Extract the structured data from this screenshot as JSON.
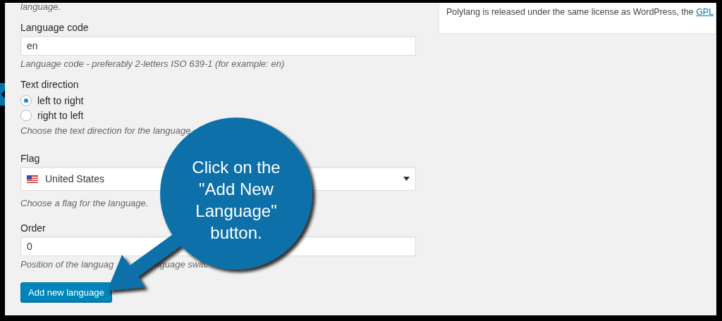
{
  "top_hint": "language.",
  "fields": [
    {
      "kind": "text",
      "label": "Language code",
      "value": "en",
      "hint": [
        "Language code - preferably 2-letters ISO 639-1 (for example: en)"
      ]
    },
    {
      "kind": "radio",
      "label": "Text direction",
      "options": [
        {
          "label": "left to right",
          "selected": true
        },
        {
          "label": "right to left",
          "selected": false
        }
      ],
      "hint": [
        "Choose the text direction for the language"
      ]
    },
    {
      "kind": "select",
      "label": "Flag",
      "value": "United States",
      "hint": [
        "Choose a flag for the language."
      ]
    },
    {
      "kind": "text",
      "label": "Order",
      "value": "0",
      "hint": [
        "Position of the languag",
        "nguage switc"
      ]
    }
  ],
  "submit": "Add new language",
  "about": {
    "text": "Polylang is released under the same license as WordPress, the",
    "link": "GPL"
  },
  "callout": {
    "lines": [
      "Click on the",
      "\"Add New",
      "Language\"",
      "button."
    ]
  }
}
